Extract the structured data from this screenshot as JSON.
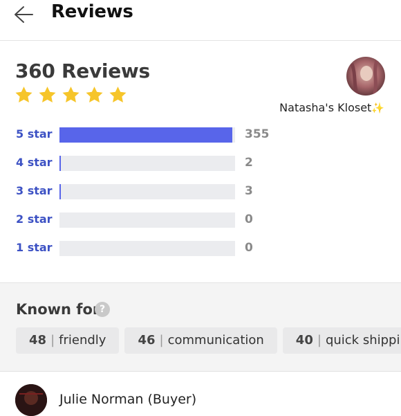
{
  "header": {
    "title": "Reviews",
    "back_icon": "back-arrow-icon"
  },
  "summary": {
    "title": "360 Reviews",
    "rating_stars": 5,
    "star_color": "#f6c52a",
    "closet_name": "Natasha's Kloset",
    "sparkle": "✨"
  },
  "breakdown": [
    {
      "label": "5 star",
      "count": "355",
      "fraction": 0.986
    },
    {
      "label": "4 star",
      "count": "2",
      "fraction": 0.006
    },
    {
      "label": "3 star",
      "count": "3",
      "fraction": 0.008
    },
    {
      "label": "2 star",
      "count": "0",
      "fraction": 0
    },
    {
      "label": "1 star",
      "count": "0",
      "fraction": 0
    }
  ],
  "colors": {
    "bar_fill": "#5865ea",
    "bar_track": "#ebecef",
    "label_blue": "#3d52c4"
  },
  "known_for": {
    "title": "Known for",
    "help_icon": "question-icon",
    "help_glyph": "?",
    "tags": [
      {
        "count": "48",
        "label": "friendly"
      },
      {
        "count": "46",
        "label": "communication"
      },
      {
        "count": "40",
        "label": "quick shipping"
      }
    ]
  },
  "first_review": {
    "name": "Julie Norman (Buyer)"
  }
}
